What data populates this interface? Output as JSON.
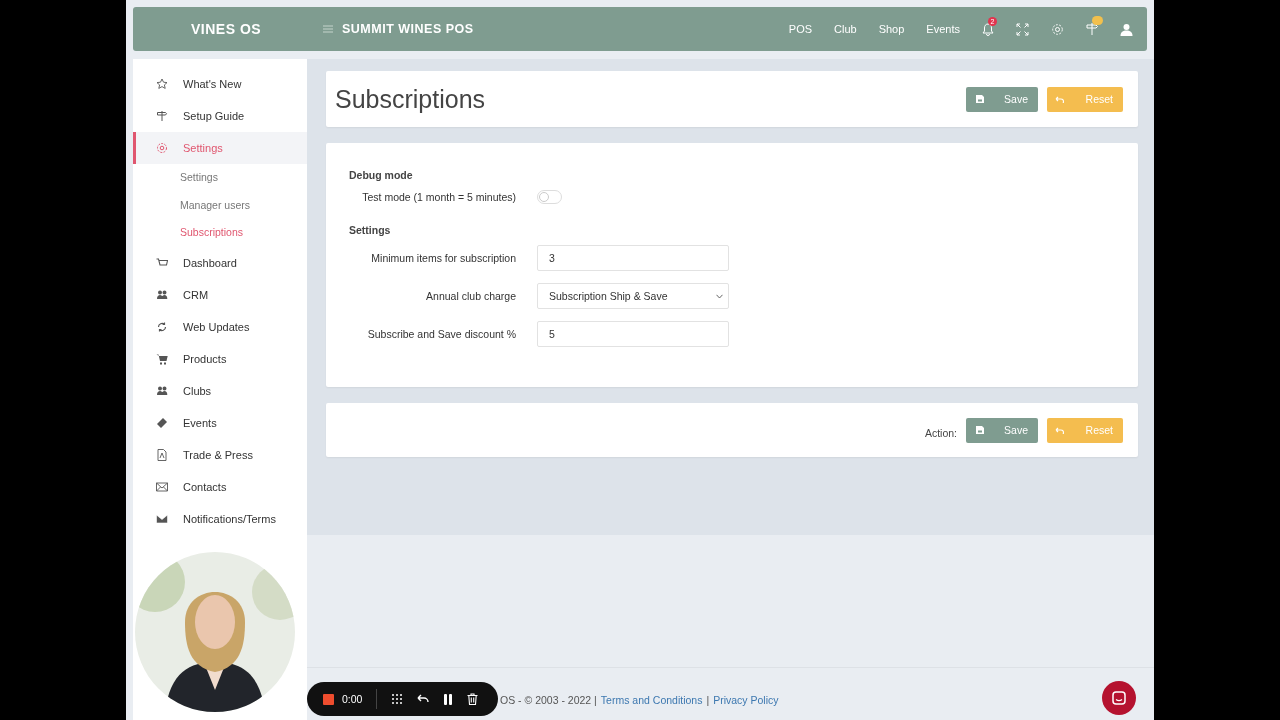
{
  "header": {
    "brand": "VINES OS",
    "store": "SUMMIT WINES POS",
    "nav": [
      "POS",
      "Club",
      "Shop",
      "Events"
    ],
    "notification_count": "2"
  },
  "sidebar": {
    "items": [
      {
        "label": "What's New",
        "selected": false
      },
      {
        "label": "Setup Guide",
        "selected": false
      },
      {
        "label": "Settings",
        "selected": true,
        "children": [
          {
            "label": "Settings",
            "selected": false
          },
          {
            "label": "Manager users",
            "selected": false
          },
          {
            "label": "Subscriptions",
            "selected": true
          }
        ]
      },
      {
        "label": "Dashboard",
        "selected": false
      },
      {
        "label": "CRM",
        "selected": false
      },
      {
        "label": "Web Updates",
        "selected": false
      },
      {
        "label": "Products",
        "selected": false
      },
      {
        "label": "Clubs",
        "selected": false
      },
      {
        "label": "Events",
        "selected": false
      },
      {
        "label": "Trade & Press",
        "selected": false
      },
      {
        "label": "Contacts",
        "selected": false
      },
      {
        "label": "Notifications/Terms",
        "selected": false
      }
    ]
  },
  "page": {
    "title": "Subscriptions",
    "buttons": [
      {
        "kind": "save",
        "label": "Save"
      },
      {
        "kind": "reset",
        "label": "Reset"
      }
    ]
  },
  "form": {
    "sections": [
      {
        "title": "Debug mode",
        "rows": [
          {
            "kind": "toggle",
            "label": "Test mode (1 month = 5 minutes)",
            "on": false
          }
        ]
      },
      {
        "title": "Settings",
        "rows": [
          {
            "kind": "input",
            "label": "Minimum items for subscription",
            "value": "3"
          },
          {
            "kind": "select",
            "label": "Annual club charge",
            "value": "Subscription Ship & Save"
          },
          {
            "kind": "input",
            "label": "Subscribe and Save discount %",
            "value": "5"
          }
        ]
      }
    ]
  },
  "actions": {
    "label": "Action:",
    "buttons": [
      {
        "kind": "save",
        "label": "Save"
      },
      {
        "kind": "reset",
        "label": "Reset"
      }
    ]
  },
  "footer": {
    "text": "OS - © 2003 - 2022 |",
    "links": [
      "Terms and Conditions",
      "Privacy Policy"
    ],
    "separator": "|"
  },
  "recorder": {
    "time": "0:00"
  }
}
